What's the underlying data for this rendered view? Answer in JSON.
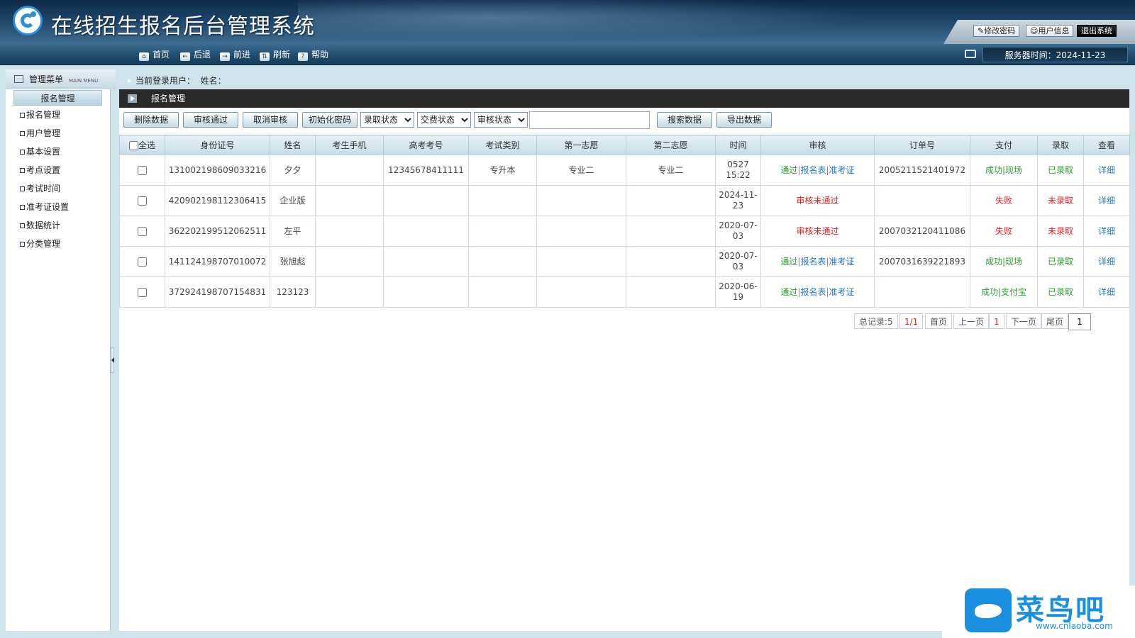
{
  "app_title": "在线招生报名后台管理系统",
  "top_links": {
    "change_password": "修改密码",
    "user_info": "用户信息",
    "logout": "退出系统"
  },
  "nav": {
    "home": "首页",
    "back": "后退",
    "forward": "前进",
    "refresh": "刷新",
    "help": "帮助"
  },
  "server_time": "服务器时间：2024-11-23",
  "sidebar": {
    "title": "管理菜单",
    "title_en": "MAIN MENU",
    "group": "报名管理",
    "items": [
      {
        "label": "报名管理"
      },
      {
        "label": "用户管理"
      },
      {
        "label": "基本设置"
      },
      {
        "label": "考点设置"
      },
      {
        "label": "考试时间"
      },
      {
        "label": "准考证设置"
      },
      {
        "label": "数据统计"
      },
      {
        "label": "分类管理"
      }
    ]
  },
  "breadcrumb": {
    "label": "当前登录用户：",
    "name_label": "姓名："
  },
  "panel_title": "报名管理",
  "actions": {
    "delete": "删除数据",
    "approve": "审核通过",
    "cancel": "取消审核",
    "reset_pwd": "初始化密码",
    "admit_status": "录取状态",
    "pay_status": "交费状态",
    "review_status": "审核状态",
    "search_value": "",
    "search": "搜索数据",
    "export": "导出数据"
  },
  "table": {
    "headers": [
      "全选",
      "身份证号",
      "姓名",
      "考生手机",
      "高考考号",
      "考试类别",
      "第一志愿",
      "第二志愿",
      "时间",
      "审核",
      "订单号",
      "支付",
      "录取",
      "查看"
    ],
    "rows": [
      {
        "id_no": "131002198609033216",
        "name": "夕夕",
        "phone": "",
        "exam_no": "12345678411111",
        "category": "专升本",
        "choice1": "专业二",
        "choice2": "专业二",
        "time": "0527\n15:22",
        "review_pass": "通过",
        "review_form": "报名表",
        "review_ticket": "准考证",
        "review_fail": "",
        "order_no": "2005211521401972",
        "pay": "成功|现场",
        "pay_ok": true,
        "admit": "已录取",
        "admit_ok": true,
        "view": "详细"
      },
      {
        "id_no": "420902198112306415",
        "name": "企业版",
        "phone": "",
        "exam_no": "",
        "category": "",
        "choice1": "",
        "choice2": "",
        "time": "2024-11-\n23",
        "review_pass": "",
        "review_form": "",
        "review_ticket": "",
        "review_fail": "审核未通过",
        "order_no": "",
        "pay": "失败",
        "pay_ok": false,
        "admit": "未录取",
        "admit_ok": false,
        "view": "详细"
      },
      {
        "id_no": "362202199512062511",
        "name": "左平",
        "phone": "",
        "exam_no": "",
        "category": "",
        "choice1": "",
        "choice2": "",
        "time": "2020-07-\n03",
        "review_pass": "",
        "review_form": "",
        "review_ticket": "",
        "review_fail": "审核未通过",
        "order_no": "2007032120411086",
        "pay": "失败",
        "pay_ok": false,
        "admit": "未录取",
        "admit_ok": false,
        "view": "详细"
      },
      {
        "id_no": "141124198707010072",
        "name": "张旭彪",
        "phone": "",
        "exam_no": "",
        "category": "",
        "choice1": "",
        "choice2": "",
        "time": "2020-07-\n03",
        "review_pass": "通过",
        "review_form": "报名表",
        "review_ticket": "准考证",
        "review_fail": "",
        "order_no": "2007031639221893",
        "pay": "成功|现场",
        "pay_ok": true,
        "admit": "已录取",
        "admit_ok": true,
        "view": "详细"
      },
      {
        "id_no": "372924198707154831",
        "name": "123123",
        "phone": "",
        "exam_no": "",
        "category": "",
        "choice1": "",
        "choice2": "",
        "time": "2020-06-\n19",
        "review_pass": "通过",
        "review_form": "报名表",
        "review_ticket": "准考证",
        "review_fail": "",
        "order_no": "",
        "pay": "成功|支付宝",
        "pay_ok": true,
        "admit": "已录取",
        "admit_ok": true,
        "view": "详细"
      }
    ]
  },
  "pager": {
    "total": "总记录:5",
    "pages": "1/1",
    "first": "首页",
    "prev": "上一页",
    "current": "1",
    "next": "下一页",
    "last": "尾页",
    "goto_value": "1"
  },
  "watermark": {
    "text": "菜鸟吧",
    "url": "www.cnlaoba.com"
  },
  "colors": {
    "header_dark": "#0e2a48",
    "toolbar": "#1f4a6c",
    "success": "#2d9a2d",
    "fail": "#d22222",
    "link": "#2a77b8",
    "panel_title": "#2a2a2a"
  }
}
